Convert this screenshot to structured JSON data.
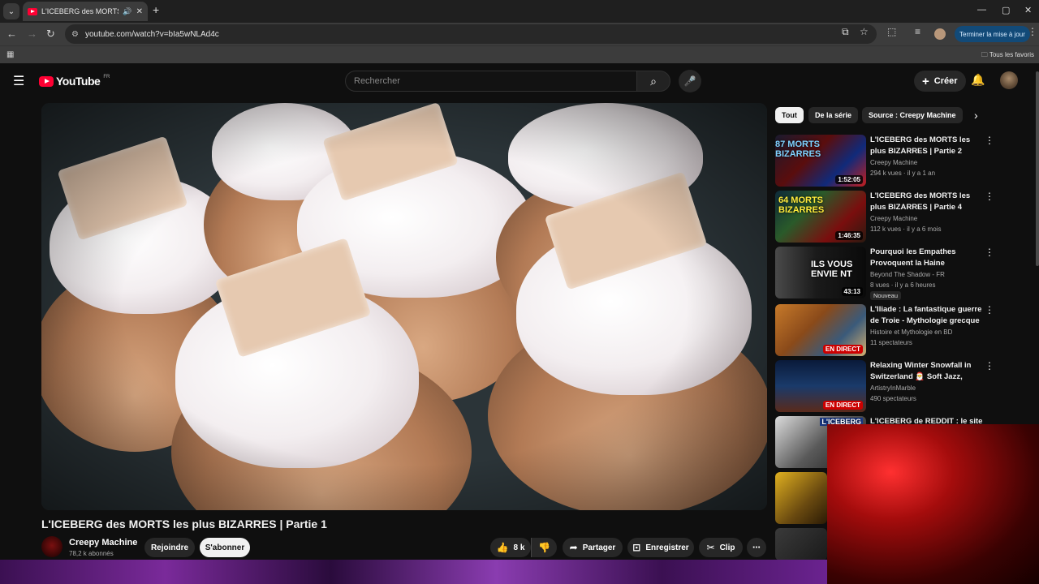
{
  "browser": {
    "tab_title": "L'ICEBERG des MORTS les p",
    "url": "youtube.com/watch?v=bIa5wNLAd4c",
    "update_button": "Terminer la mise à jour",
    "bookmarks_all": "Tous les favoris"
  },
  "header": {
    "logo_text": "YouTube",
    "logo_region": "FR",
    "search_placeholder": "Rechercher",
    "create_label": "Créer"
  },
  "video": {
    "title": "L'ICEBERG des MORTS les plus BIZARRES | Partie 1",
    "channel_name": "Creepy Machine",
    "subscribers": "78,2 k abonnés",
    "join_label": "Rejoindre",
    "subscribe_label": "S'abonner",
    "like_count": "8 k",
    "share_label": "Partager",
    "save_label": "Enregistrer",
    "clip_label": "Clip"
  },
  "chips": [
    "Tout",
    "De la série",
    "Source : Creepy Machine"
  ],
  "recommendations": [
    {
      "title": "L'ICEBERG des MORTS les plus BIZARRES | Partie 2",
      "channel": "Creepy Machine",
      "meta": "294 k vues · il y a 1 an",
      "duration": "1:52:05",
      "thumb_text": "87 MORTS BIZARRES"
    },
    {
      "title": "L'ICEBERG des MORTS les plus BIZARRES | Partie 4",
      "channel": "Creepy Machine",
      "meta": "112 k vues · il y a 6 mois",
      "duration": "1:46:35",
      "thumb_text": "64 MORTS BIZARRES"
    },
    {
      "title": "Pourquoi les Empathes Provoquent la Haine Silencieu...",
      "channel": "Beyond The Shadow - FR",
      "meta": "8 vues · il y a 6 heures",
      "duration": "43:13",
      "badge": "Nouveau",
      "thumb_text": "ILS VOUS ENVIE NT"
    },
    {
      "title": "L'Iliade : La fantastique guerre de Troie - Mythologie grecque",
      "channel": "Histoire et Mythologie en BD",
      "meta": "11 spectateurs",
      "live": "EN DIRECT"
    },
    {
      "title": "Relaxing Winter Snowfall in Switzerland 🎅 Soft Jazz, Coz...",
      "channel": "ArtistryInMarble",
      "meta": "490 spectateurs",
      "live": "EN DIRECT"
    },
    {
      "title": "L'ICEBERG de REDDIT : le site le",
      "thumb_text": "L'ICEBERG"
    }
  ]
}
